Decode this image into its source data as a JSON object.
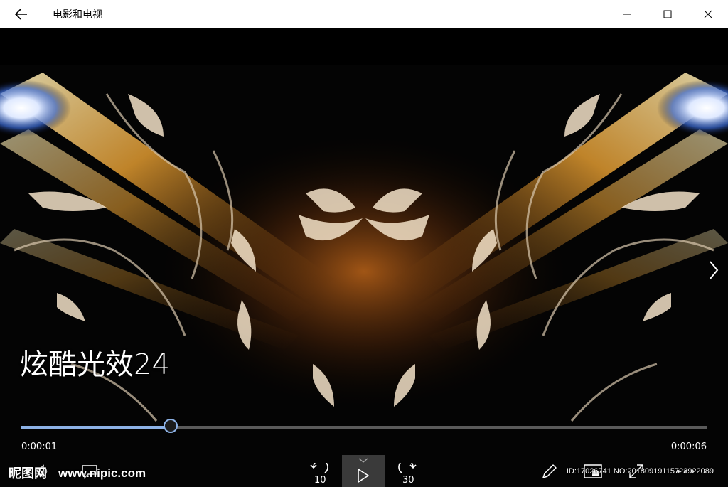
{
  "window": {
    "title": "电影和电视"
  },
  "video": {
    "title": "炫酷光效24",
    "elapsed": "0:00:01",
    "duration": "0:00:06",
    "progress": 0.218
  },
  "controls": {
    "rewind_seconds": "10",
    "forward_seconds": "30"
  },
  "watermark": {
    "logo": "昵图网",
    "url": "www.nipic.com",
    "id_text": "ID:17026741 NO:20180919115723922089"
  },
  "colors": {
    "accent": "#8db2e6",
    "titlebar_bg": "#ffffff",
    "player_bg": "#000000",
    "play_button_bg": "#3a3a3a"
  },
  "icons": {
    "back": "arrow-left-icon",
    "minimize": "minimize-icon",
    "maximize": "maximize-icon",
    "close": "close-icon",
    "next": "chevron-right-icon",
    "play": "play-icon",
    "rewind": "rewind-icon",
    "forward": "forward-icon",
    "volume": "volume-icon",
    "subtitle": "subtitle-icon",
    "pen": "pen-icon",
    "mini_view": "mini-view-icon",
    "fullscreen": "fullscreen-icon",
    "more": "more-icon"
  }
}
